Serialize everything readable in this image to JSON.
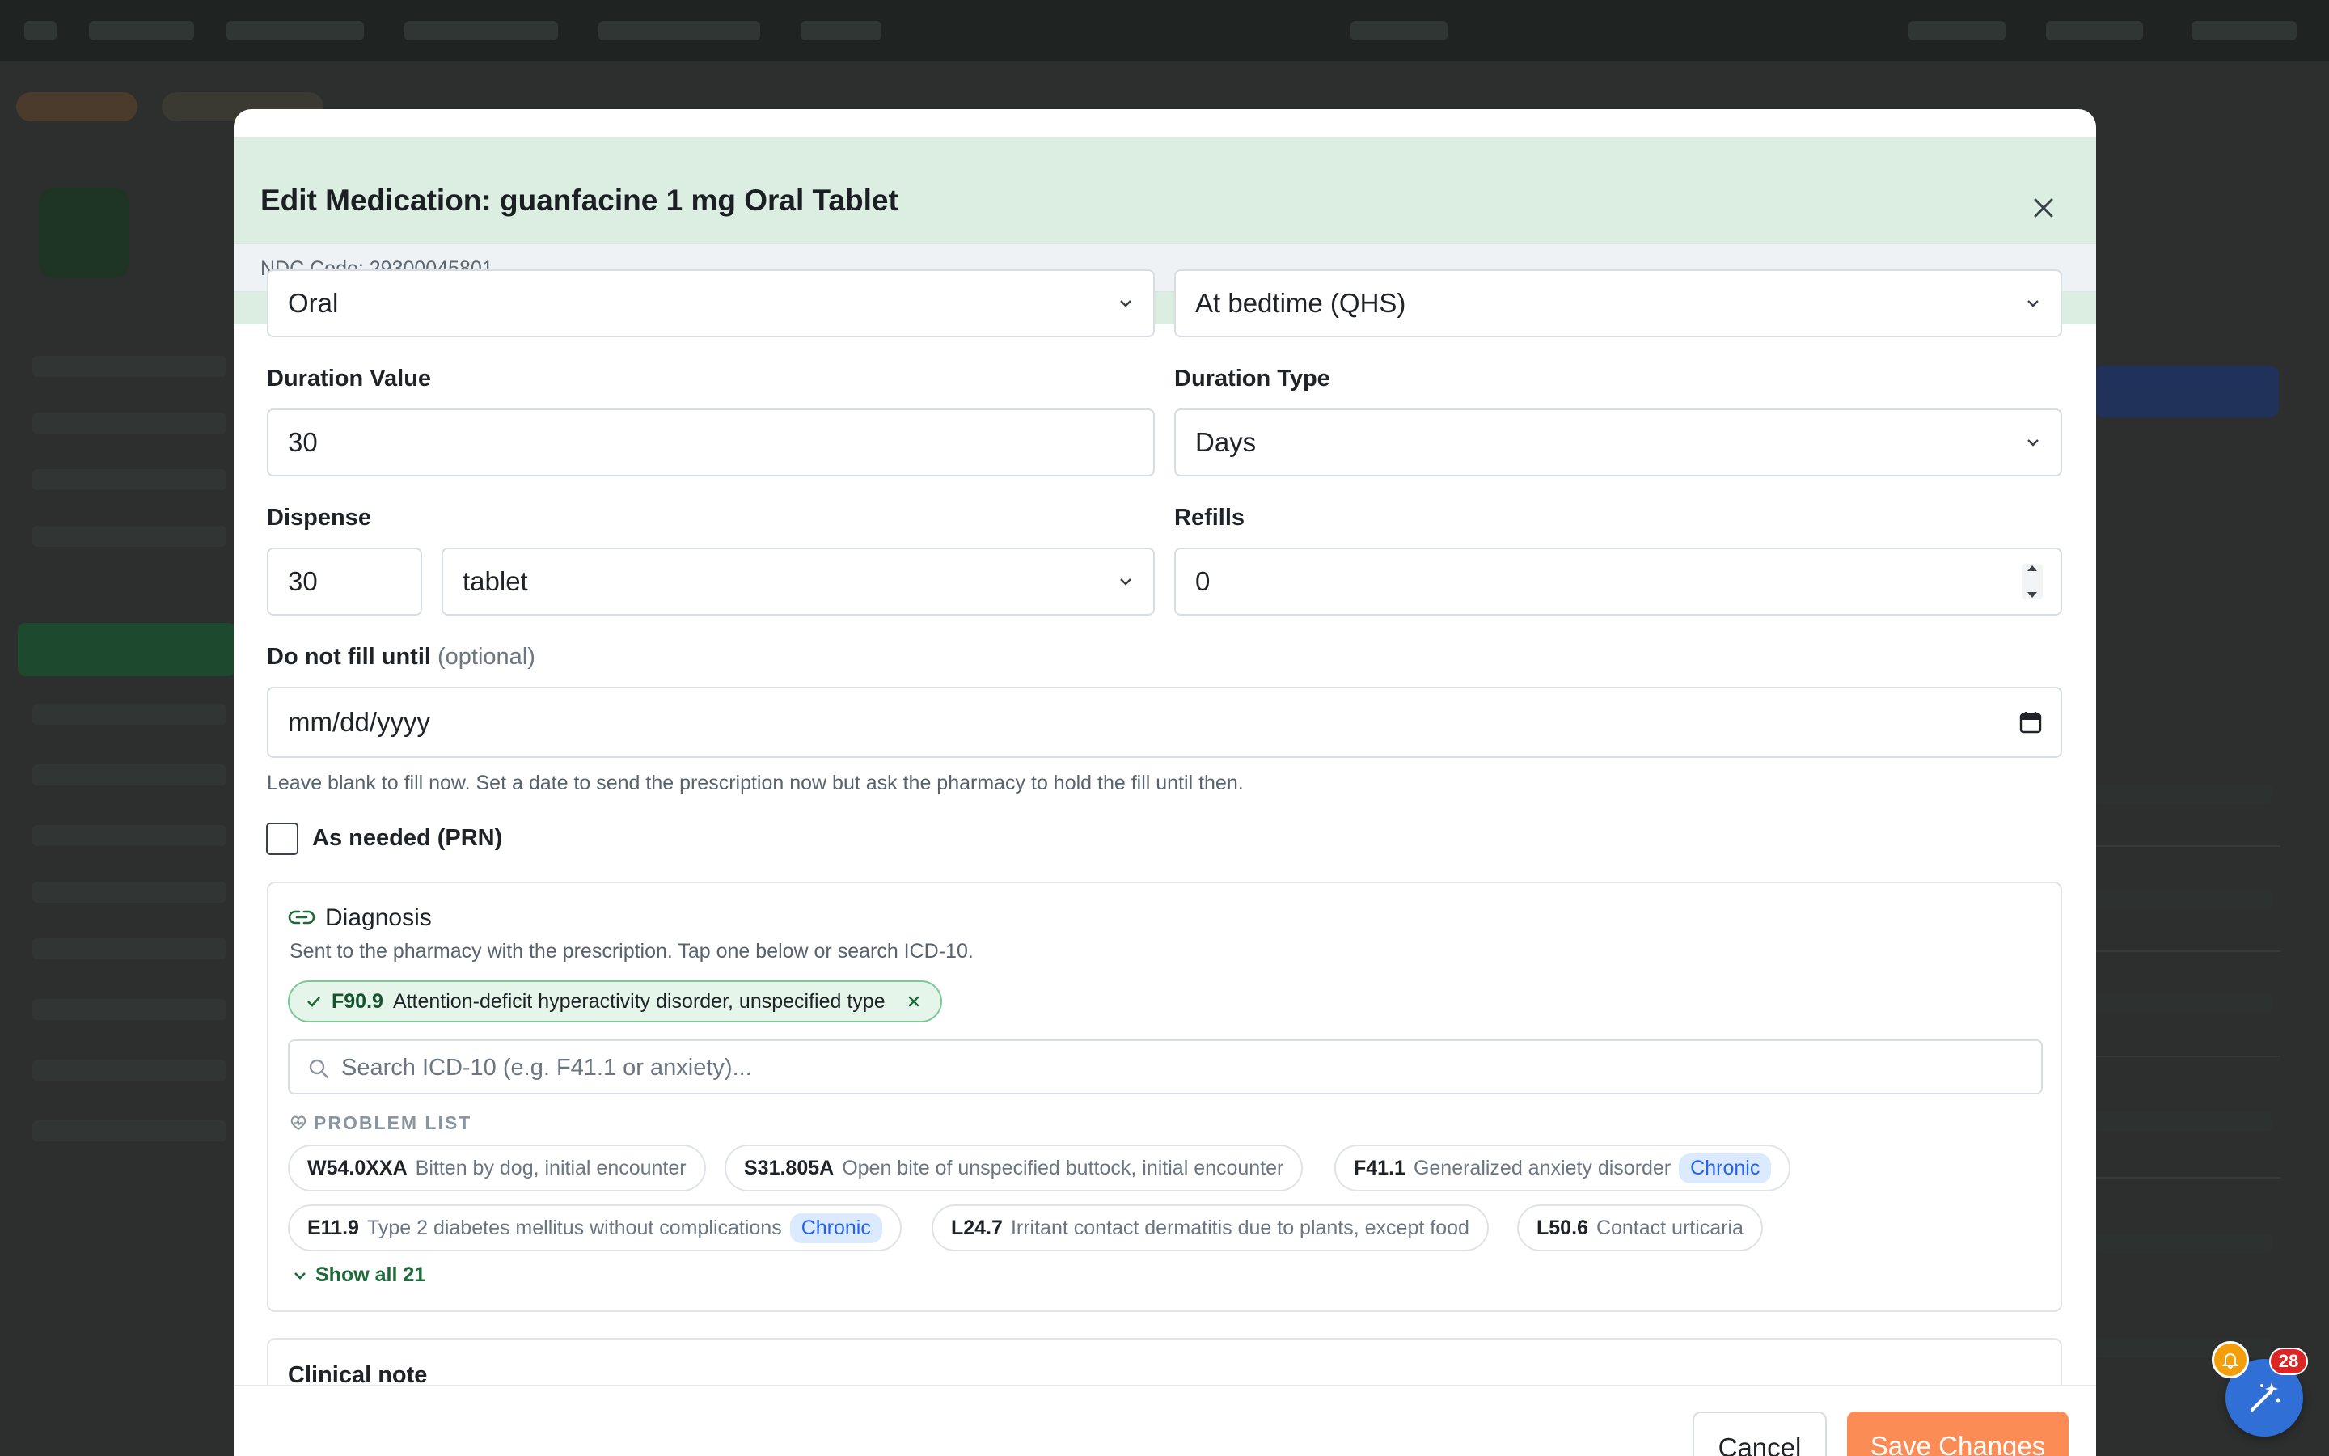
{
  "modal": {
    "title": "Edit Medication: guanfacine 1 mg Oral Tablet",
    "ndc": "NDC Code: 29300045801",
    "route": {
      "value": "Oral"
    },
    "frequency": {
      "value": "At bedtime (QHS)"
    },
    "duration_value": {
      "label": "Duration Value",
      "value": "30"
    },
    "duration_type": {
      "label": "Duration Type",
      "value": "Days"
    },
    "dispense": {
      "label": "Dispense",
      "qty": "30",
      "unit": "tablet"
    },
    "refills": {
      "label": "Refills",
      "value": "0"
    },
    "fill_until": {
      "label": "Do not fill until",
      "optional": "(optional)",
      "placeholder": "mm/dd/yyyy",
      "help": "Leave blank to fill now. Set a date to send the prescription now but ask the pharmacy to hold the fill until then."
    },
    "prn": {
      "label": "As needed (PRN)",
      "checked": false
    },
    "diagnosis": {
      "title": "Diagnosis",
      "subtitle": "Sent to the pharmacy with the prescription. Tap one below or search ICD-10.",
      "selected": {
        "code": "F90.9",
        "desc": "Attention-deficit hyperactivity disorder, unspecified type"
      },
      "search_placeholder": "Search ICD-10 (e.g. F41.1 or anxiety)...",
      "problem_list_title": "PROBLEM LIST",
      "problems": [
        {
          "code": "W54.0XXA",
          "desc": "Bitten by dog, initial encounter",
          "tag": ""
        },
        {
          "code": "S31.805A",
          "desc": "Open bite of unspecified buttock, initial encounter",
          "tag": ""
        },
        {
          "code": "F41.1",
          "desc": "Generalized anxiety disorder",
          "tag": "Chronic"
        },
        {
          "code": "E11.9",
          "desc": "Type 2 diabetes mellitus without complications",
          "tag": "Chronic"
        },
        {
          "code": "L24.7",
          "desc": "Irritant contact dermatitis due to plants, except food",
          "tag": ""
        },
        {
          "code": "L50.6",
          "desc": "Contact urticaria",
          "tag": ""
        }
      ],
      "show_all": "Show all 21"
    },
    "clinical_note": {
      "label": "Clinical note"
    },
    "buttons": {
      "cancel": "Cancel",
      "save": "Save Changes"
    }
  },
  "widget": {
    "badge": "28"
  },
  "colors": {
    "header_bg": "#dbeee1",
    "save_bg": "#fb8c55",
    "accent_green": "#1d6a3a",
    "chronic_tag": "#2563eb"
  }
}
